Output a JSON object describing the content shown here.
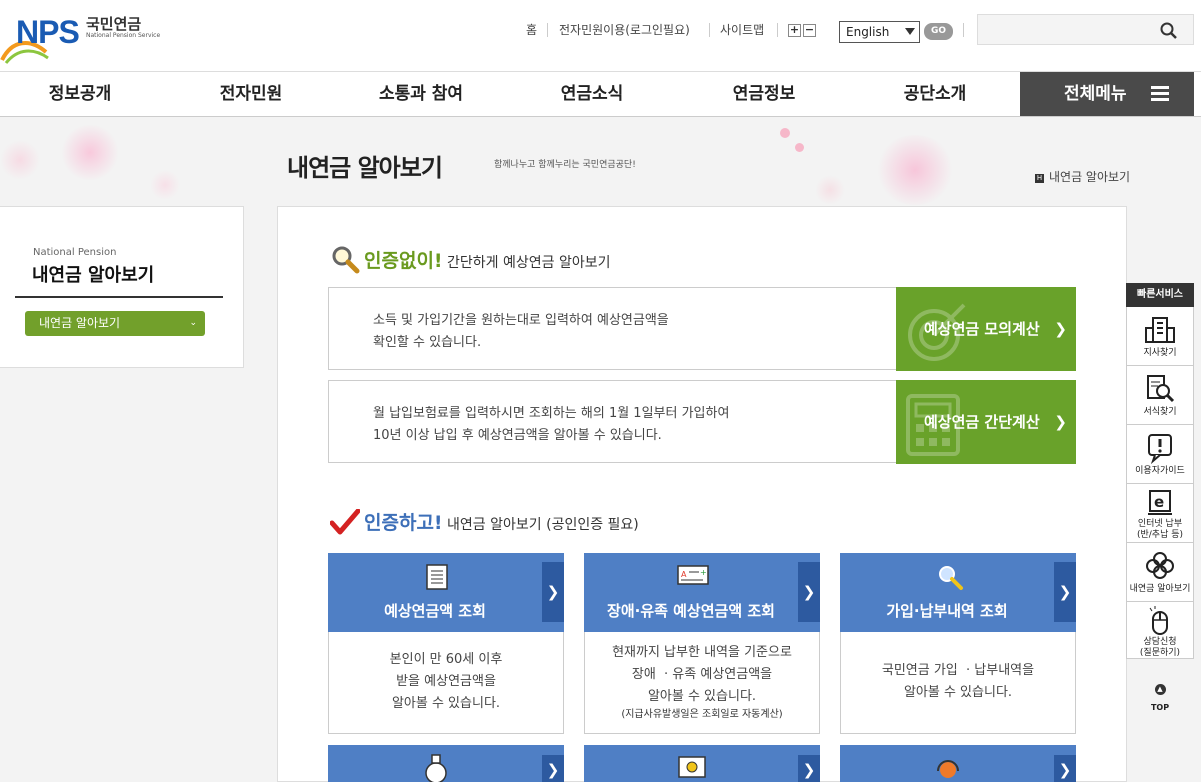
{
  "header": {
    "logo_en": "NPS",
    "logo_kr": "국민연금",
    "logo_sub": "National Pension Service",
    "util_links": [
      "홈",
      "전자민원이용(로그인필요)",
      "사이트맵"
    ],
    "zoom_in": "+",
    "zoom_out": "−",
    "language": "English",
    "go_label": "GO",
    "search_placeholder": ""
  },
  "gnb": {
    "items": [
      "정보공개",
      "전자민원",
      "소통과 참여",
      "연금소식",
      "연금정보",
      "공단소개"
    ],
    "all_menu": "전체메뉴"
  },
  "page": {
    "title": "내연금 알아보기",
    "slogan": "함께나누고 함께누리는 국민연금공단!",
    "breadcrumb": "내연금 알아보기"
  },
  "sidebar": {
    "en_title": "National Pension",
    "title": "내연금 알아보기",
    "select_label": "내연금 알아보기"
  },
  "section1": {
    "em": "인증없이!",
    "rest": " 간단하게 예상연금 알아보기",
    "rows": [
      {
        "line1": "소득 및 가입기간을 원하는대로 입력하여 예상연금액을",
        "line2": "확인할 수 있습니다.",
        "button": "예상연금 모의계산"
      },
      {
        "line1": "월 납입보험료를 입력하시면 조회하는 해의 1월 1일부터 가입하여",
        "line2": "10년 이상 납입 후 예상연금액을 알아볼 수 있습니다.",
        "button": "예상연금 간단계산"
      }
    ]
  },
  "section2": {
    "em": "인증하고!",
    "rest": " 내연금 알아보기 (공인인증 필요)",
    "cards": [
      {
        "title": "예상연금액 조회",
        "lines": [
          "본인이 만 60세 이후",
          "받을 예상연금액을",
          "알아볼 수 있습니다."
        ],
        "note": ""
      },
      {
        "title": "장애·유족 예상연금액 조회",
        "lines": [
          "현재까지 납부한 내역을 기준으로",
          "장애  · 유족 예상연금액을",
          "알아볼 수 있습니다."
        ],
        "note": "(지급사유발생일은 조회일로 자동계산)"
      },
      {
        "title": "가입·납부내역 조회",
        "lines": [
          "국민연금 가입  · 납부내역을",
          "알아볼 수 있습니다."
        ],
        "note": ""
      }
    ]
  },
  "quick": {
    "title": "빠른서비스",
    "items": [
      {
        "icon": "building-icon",
        "label": "지사찾기"
      },
      {
        "icon": "document-search-icon",
        "label": "서식찾기"
      },
      {
        "icon": "exclamation-bubble-icon",
        "label": "이용자가이드"
      },
      {
        "icon": "internet-e-icon",
        "label": "인터넷 납부\n(반/추납 등)"
      },
      {
        "icon": "clover-icon",
        "label": "내연금 알아보기"
      },
      {
        "icon": "mouse-icon",
        "label": "상담신청\n(질문하기)"
      }
    ],
    "top": "TOP"
  },
  "colors": {
    "brand_blue": "#1a5bb3",
    "green": "#69a22a",
    "card_blue": "#4f7fc5",
    "dark_menu": "#4a4a4a"
  }
}
